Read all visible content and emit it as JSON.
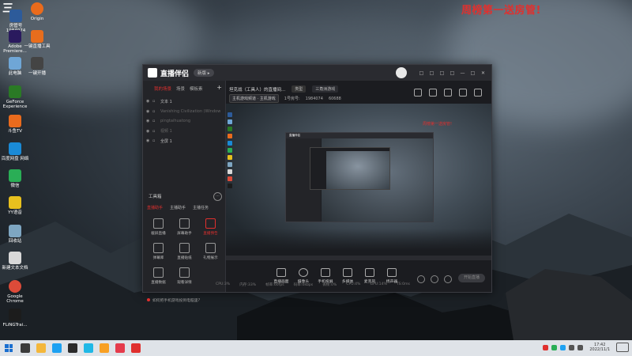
{
  "desktop": {
    "headline": "周榜第一送房管!",
    "logo_text": "三",
    "icons": [
      {
        "label": "房管号\n1984074",
        "color": "#2d5b9a"
      },
      {
        "label": "Adobe\nPremiere...",
        "color": "#2a1a5e"
      },
      {
        "label": "此电脑",
        "color": "#6fa6d6"
      },
      {
        "label": "GeForce\nExperience",
        "color": "#2a7a25"
      },
      {
        "label": "斗鱼TV",
        "color": "#e96b1d"
      },
      {
        "label": "百度网盘\n网络",
        "color": "#1a8ad6"
      },
      {
        "label": "微信",
        "color": "#2aae56"
      },
      {
        "label": "YY语音",
        "color": "#e8c01e"
      },
      {
        "label": "回收站",
        "color": "#7ea6c2"
      },
      {
        "label": "新建文本文档",
        "color": "#d8d8d8"
      },
      {
        "label": "Google\nChrome",
        "color": "#dd4b39"
      },
      {
        "label": "FLiNGTrai...",
        "color": "#1c1c1c"
      },
      {
        "label": "Origin",
        "color": "#ea6b1c"
      },
      {
        "label": "一键直播工具",
        "color": "#e76d1d"
      },
      {
        "label": "一键开播",
        "color": "#444"
      }
    ]
  },
  "window": {
    "app_name": "直播伴侣",
    "version": "新版 ▸",
    "title_buttons": [
      "□",
      "□",
      "□",
      "□",
      "—",
      "□",
      "✕"
    ],
    "tabs": [
      "我的场景",
      "场景",
      "模板素",
      "+"
    ],
    "active_tab_index": 0,
    "scenes": [
      {
        "name": "文本 1",
        "dim": false
      },
      {
        "name": "Vanishing Civilization (Window",
        "dim": true
      },
      {
        "name": "pingtaihuatong",
        "dim": true
      },
      {
        "name": "视频 1",
        "dim": true
      },
      {
        "name": "全屏 1",
        "dim": false
      }
    ],
    "tools_label": "工具箱",
    "tools_more": "···",
    "tool_tabs": [
      "直播助手",
      "主播助手",
      "主播任务"
    ],
    "tools": [
      {
        "label": "截屏直播",
        "hot": false
      },
      {
        "label": "屏幕助手",
        "hot": false
      },
      {
        "label": "直播预告",
        "hot": true
      },
      {
        "label": "弹幕库",
        "hot": false
      },
      {
        "label": "直播贴纸",
        "hot": false
      },
      {
        "label": "礼物展示",
        "hot": false
      },
      {
        "label": "直播数据",
        "hot": false
      },
      {
        "label": "观看详情",
        "hot": false
      }
    ],
    "hint": "如何把手机游戏投到电脑里?",
    "info": {
      "title": "坦克战（工具人）的直播间...",
      "category": "类型",
      "subcategory": "三角洲游戏",
      "badge": "主机游戏频道 · 主机游戏",
      "room_label": "1号房号:",
      "room_id": "1984074",
      "fans": "60688"
    },
    "preview_headline": "周榜第一送房管!",
    "bottom_items": [
      "直播画面",
      "摄像头",
      "手机投屏",
      "多媒体",
      "麦克风",
      "扬声器"
    ],
    "start_live": "开始直播",
    "status": [
      "CPU:3%",
      "内存:33%",
      "帧率:60fps",
      "码率:0kbps",
      "丢帧:0%",
      "CPU:4%",
      "GPU:14%",
      "TS:0ms"
    ]
  },
  "taskbar": {
    "apps": [
      "#3b3b3b",
      "#f4b73b",
      "#1da1f2",
      "#2b2b2b",
      "#20b8e6",
      "#f8a024",
      "#e53b4b",
      "#e0302e"
    ],
    "time": "17:42",
    "date": "2022/11/1"
  }
}
